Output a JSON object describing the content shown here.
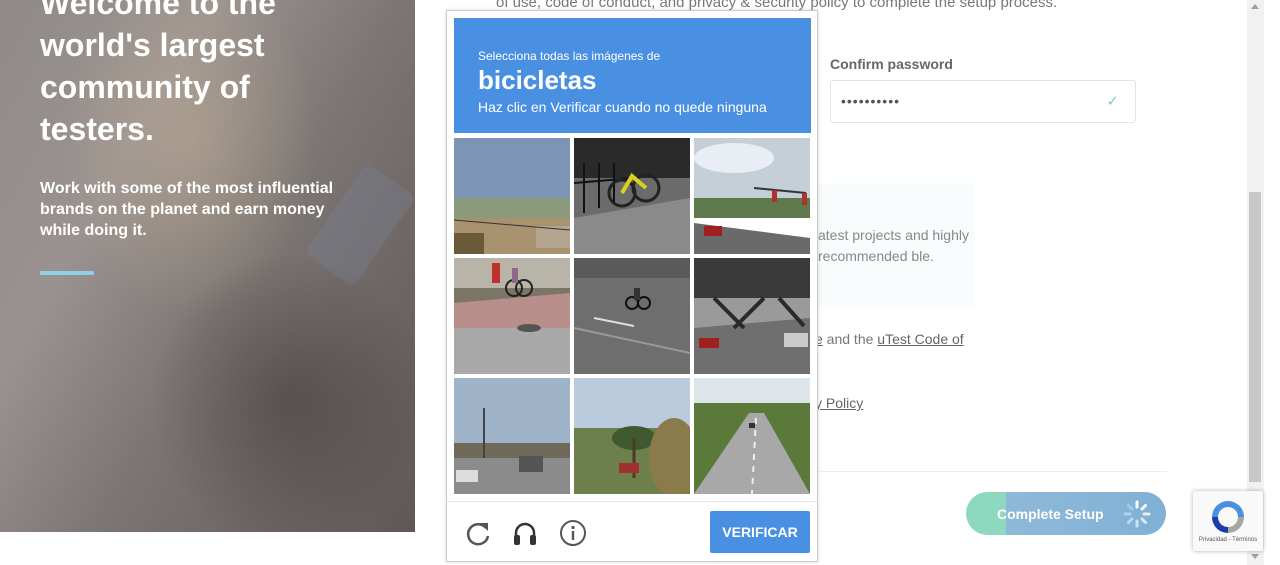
{
  "hero": {
    "title": "Welcome to the world's largest community of testers.",
    "subtitle": "Work with some of the most influential brands on the planet and earn money while doing it."
  },
  "form": {
    "top_text": "of use, code of conduct, and privacy & security policy to complete the setup process.",
    "confirm_password_label": "Confirm password",
    "confirm_password_value": "••••••••••",
    "info_text": "atest projects and highly recommended ble.",
    "terms_line1_prefix": "e",
    "terms_line1_middle": " and the ",
    "terms_line1_link": "uTest Code of",
    "terms_line2_link": "y Policy",
    "complete_button": "Complete Setup",
    "colors": {
      "accent": "#7fb1d6",
      "success": "#8fd8c0"
    }
  },
  "captcha": {
    "instruction": "Selecciona todas las imágenes de",
    "target": "bicicletas",
    "hint": "Haz clic en Verificar cuando no quede ninguna",
    "verify_label": "VERIFICAR",
    "reload_icon": "reload-icon",
    "audio_icon": "headphones-icon",
    "info_icon": "info-icon",
    "header_color": "#4a90e2",
    "tiles": [
      {
        "name": "street-scene-1"
      },
      {
        "name": "bicycle-parked"
      },
      {
        "name": "intersection-traffic-light"
      },
      {
        "name": "cyclists-street"
      },
      {
        "name": "cyclist-road"
      },
      {
        "name": "bridge-underpass"
      },
      {
        "name": "street-with-car"
      },
      {
        "name": "palm-tree-hillside"
      },
      {
        "name": "highway-road"
      }
    ]
  },
  "recaptcha_badge": {
    "text": "Privacidad - Términos"
  }
}
